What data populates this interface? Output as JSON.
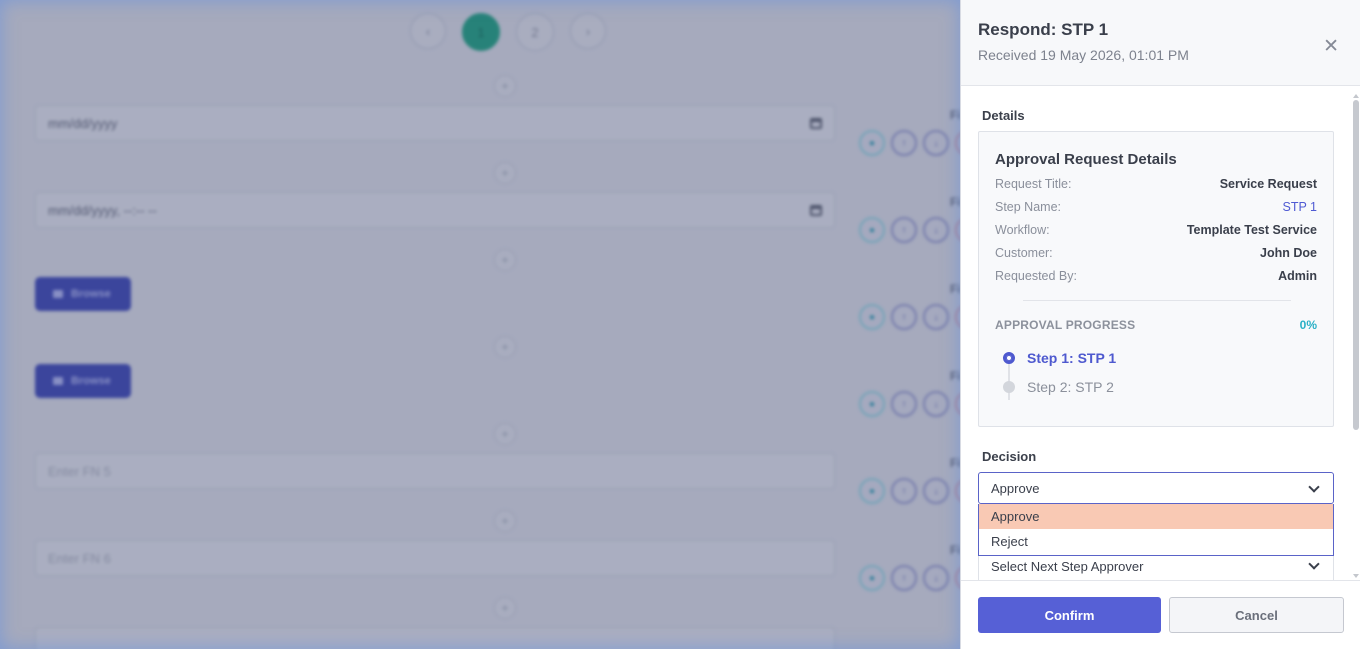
{
  "background": {
    "pager": {
      "prev_icon": "chevron-left-icon",
      "next_icon": "chevron-right-icon",
      "pages": [
        "1",
        "2"
      ],
      "active_page": "1"
    },
    "plus_icon": "plus-icon",
    "fields": [
      {
        "type": "date",
        "value": "mm/dd/yyyy",
        "icon": "calendar-icon"
      },
      {
        "type": "datetime",
        "value": "mm/dd/yyyy, --:-- --",
        "icon": "calendar-icon"
      },
      {
        "type": "file",
        "label": "Browse",
        "icon": "folder-icon"
      },
      {
        "type": "file",
        "label": "Browse",
        "icon": "folder-icon"
      },
      {
        "type": "text",
        "placeholder": "Enter FN 5"
      },
      {
        "type": "text",
        "placeholder": "Enter FN 6"
      }
    ],
    "field_side_label": "Fi"
  },
  "panel": {
    "title": "Respond: STP 1",
    "subtitle": "Received 19 May 2026, 01:01 PM",
    "close_icon": "close-icon",
    "details_label": "Details",
    "card": {
      "title": "Approval Request Details",
      "rows": [
        {
          "key": "Request Title:",
          "value": "Service Request"
        },
        {
          "key": "Step Name:",
          "value": "STP 1"
        },
        {
          "key": "Workflow:",
          "value": "Template Test Service"
        },
        {
          "key": "Customer:",
          "value": "John Doe"
        },
        {
          "key": "Requested By:",
          "value": "Admin"
        }
      ],
      "progress_label": "APPROVAL PROGRESS",
      "progress_value": "0%",
      "steps": [
        {
          "label": "Step 1: STP 1",
          "state": "active"
        },
        {
          "label": "Step 2: STP 2",
          "state": "pending"
        }
      ]
    },
    "decision": {
      "label": "Decision",
      "selected": "Approve",
      "options": [
        "Approve",
        "Reject"
      ],
      "highlighted": "Approve"
    },
    "next_approver": {
      "placeholder": "Select Next Step Approver"
    },
    "confirm_label": "Confirm",
    "cancel_label": "Cancel"
  },
  "colors": {
    "primary": "#5660d6",
    "link": "#4e59cf",
    "progress": "#2ab0c6",
    "option_highlight": "#f9c9b4",
    "pager_active": "#1f9d7a"
  }
}
